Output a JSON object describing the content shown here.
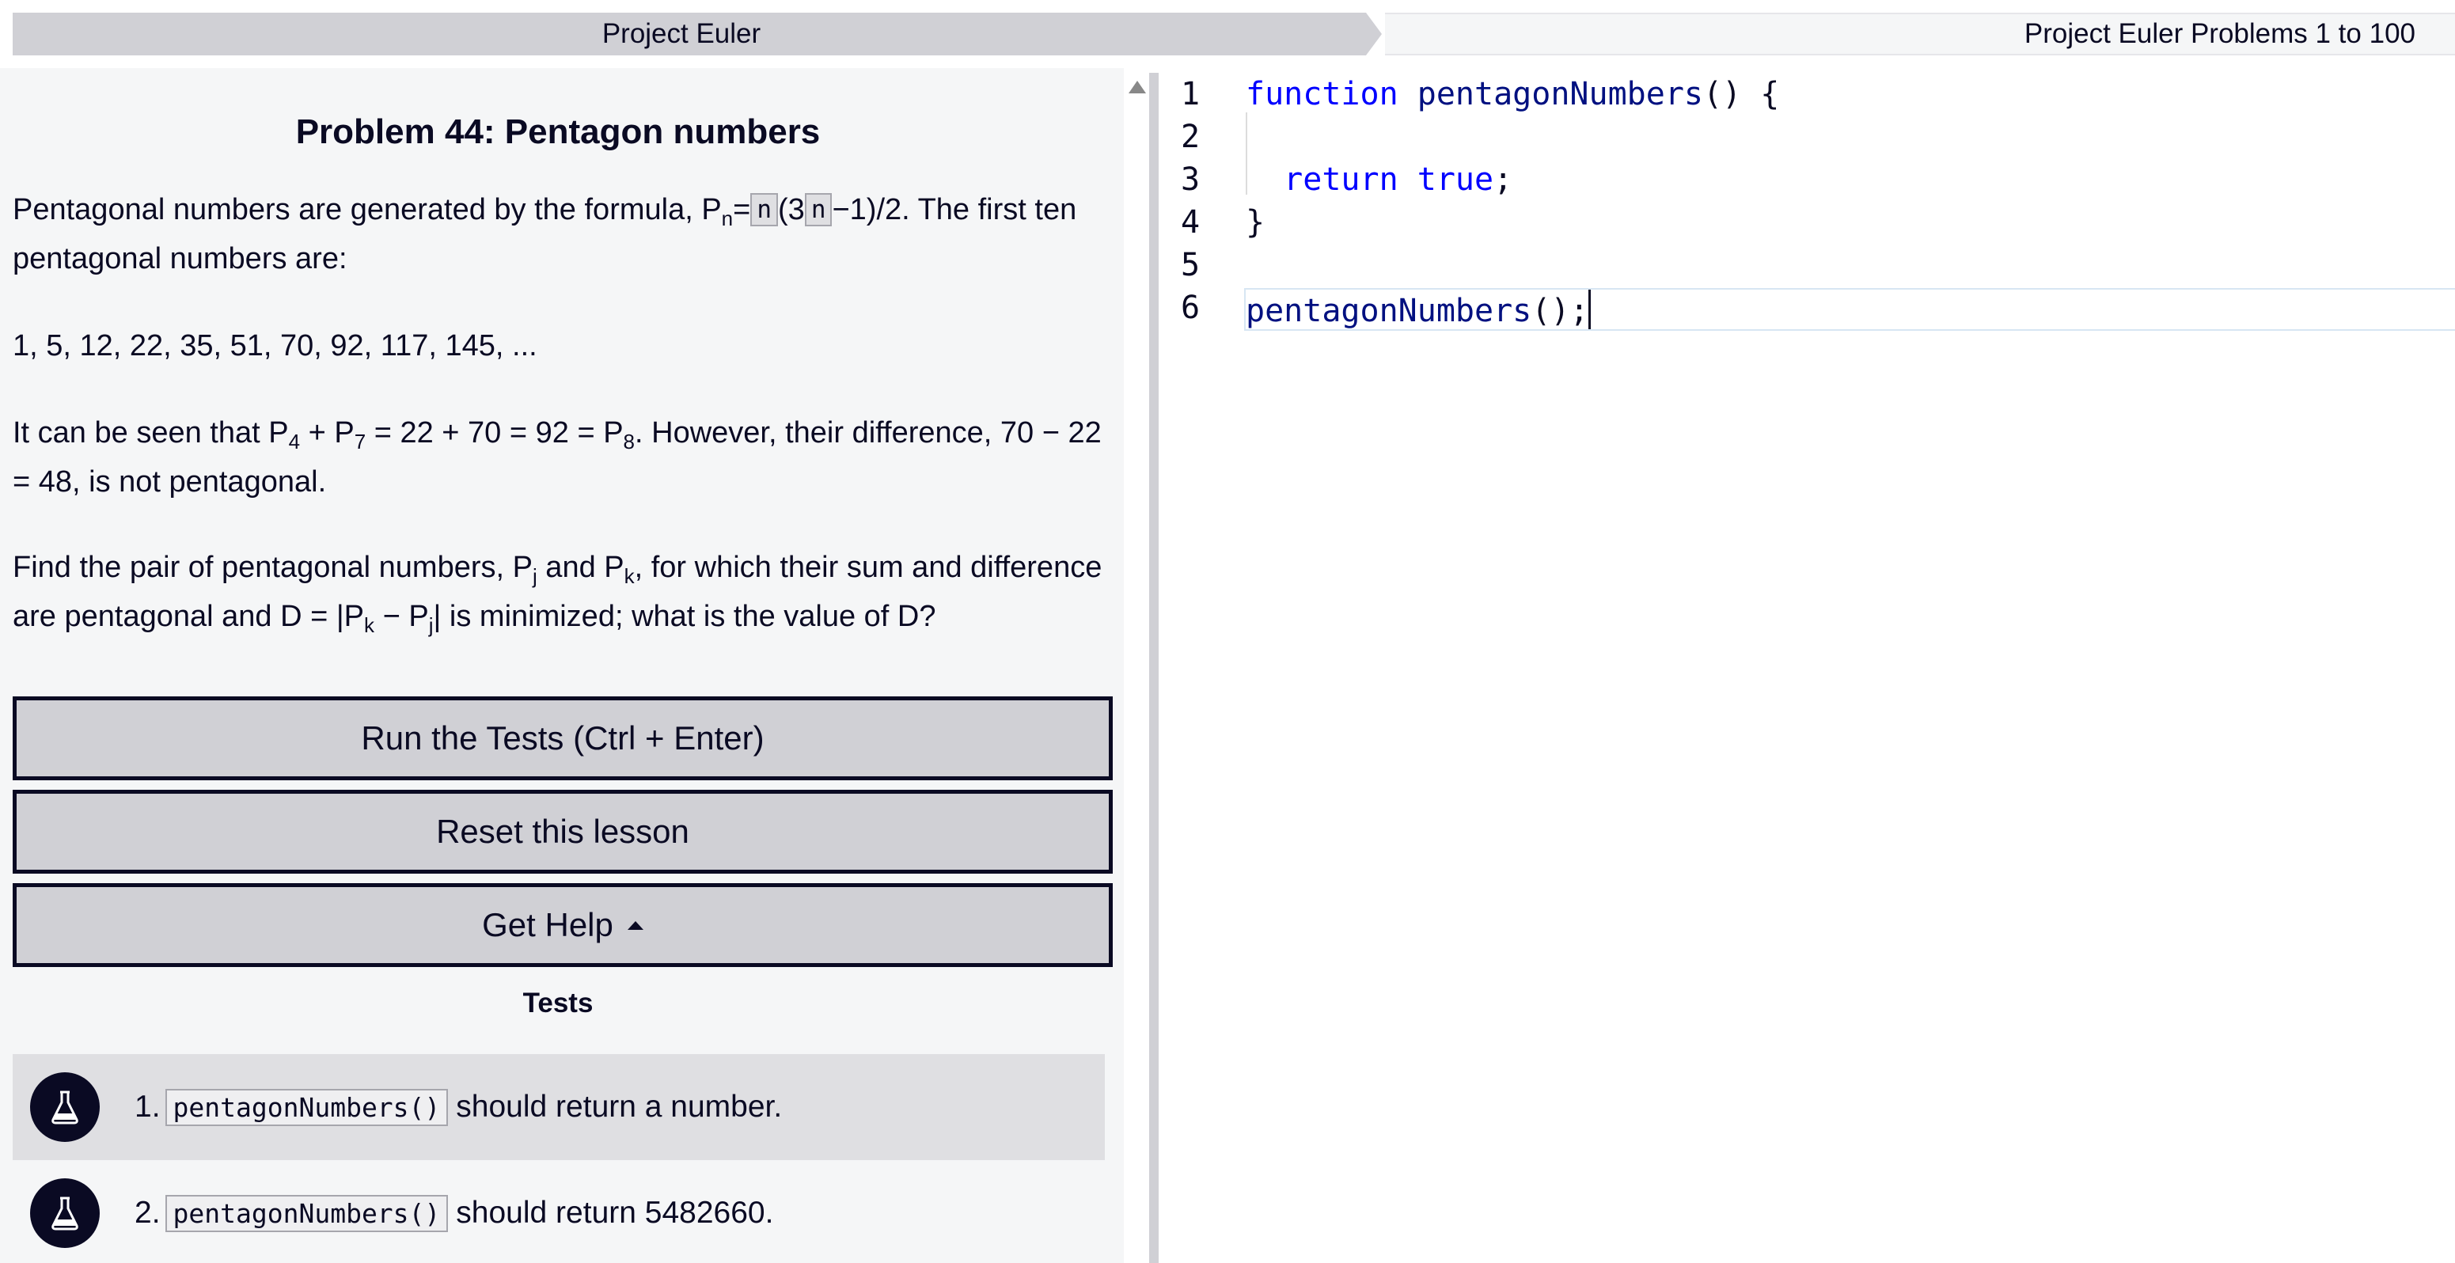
{
  "breadcrumb": {
    "left": "Project Euler",
    "right": "Project Euler Problems 1 to 100"
  },
  "challenge": {
    "title": "Problem 44: Pentagon numbers",
    "p1_a": "Pentagonal numbers are generated by the formula, P",
    "p1_sub": "n",
    "p1_eq": "=",
    "p1_n1": "n",
    "p1_mid": "(3",
    "p1_n2": "n",
    "p1_b": "−1)/2. The first ten pentagonal numbers are:",
    "p2": "1, 5, 12, 22, 35, 51, 70, 92, 117, 145, ...",
    "p3_a": "It can be seen that P",
    "p3_s1": "4",
    "p3_b": " + P",
    "p3_s2": "7",
    "p3_c": " = 22 + 70 = 92 = P",
    "p3_s3": "8",
    "p3_d": ". However, their difference, 70 − 22 = 48, is not pentagonal.",
    "p4_a": "Find the pair of pentagonal numbers, P",
    "p4_s1": "j",
    "p4_b": " and P",
    "p4_s2": "k",
    "p4_c": ", for which their sum and difference are pentagonal and D = |P",
    "p4_s3": "k",
    "p4_d": " − P",
    "p4_s4": "j",
    "p4_e": "| is minimized; what is the value of D?"
  },
  "buttons": {
    "run": "Run the Tests (Ctrl + Enter)",
    "reset": "Reset this lesson",
    "help": "Get Help"
  },
  "tests": {
    "heading": "Tests",
    "items": [
      {
        "num": "1.",
        "code": "pentagonNumbers()",
        "text": "should return a number."
      },
      {
        "num": "2.",
        "code": "pentagonNumbers()",
        "text": "should return 5482660."
      }
    ]
  },
  "editor": {
    "line_numbers": [
      "1",
      "2",
      "3",
      "4",
      "5",
      "6"
    ],
    "l1_kw": "function",
    "l1_fn": "pentagonNumbers",
    "l1_rest": "() {",
    "l3_kw": "return",
    "l3_val": "true",
    "l3_rest": ";",
    "l4": "}",
    "l6_fn": "pentagonNumbers",
    "l6_rest": "();"
  },
  "icons": {
    "test_status": "flask-icon",
    "help_caret": "caret-up-icon"
  }
}
